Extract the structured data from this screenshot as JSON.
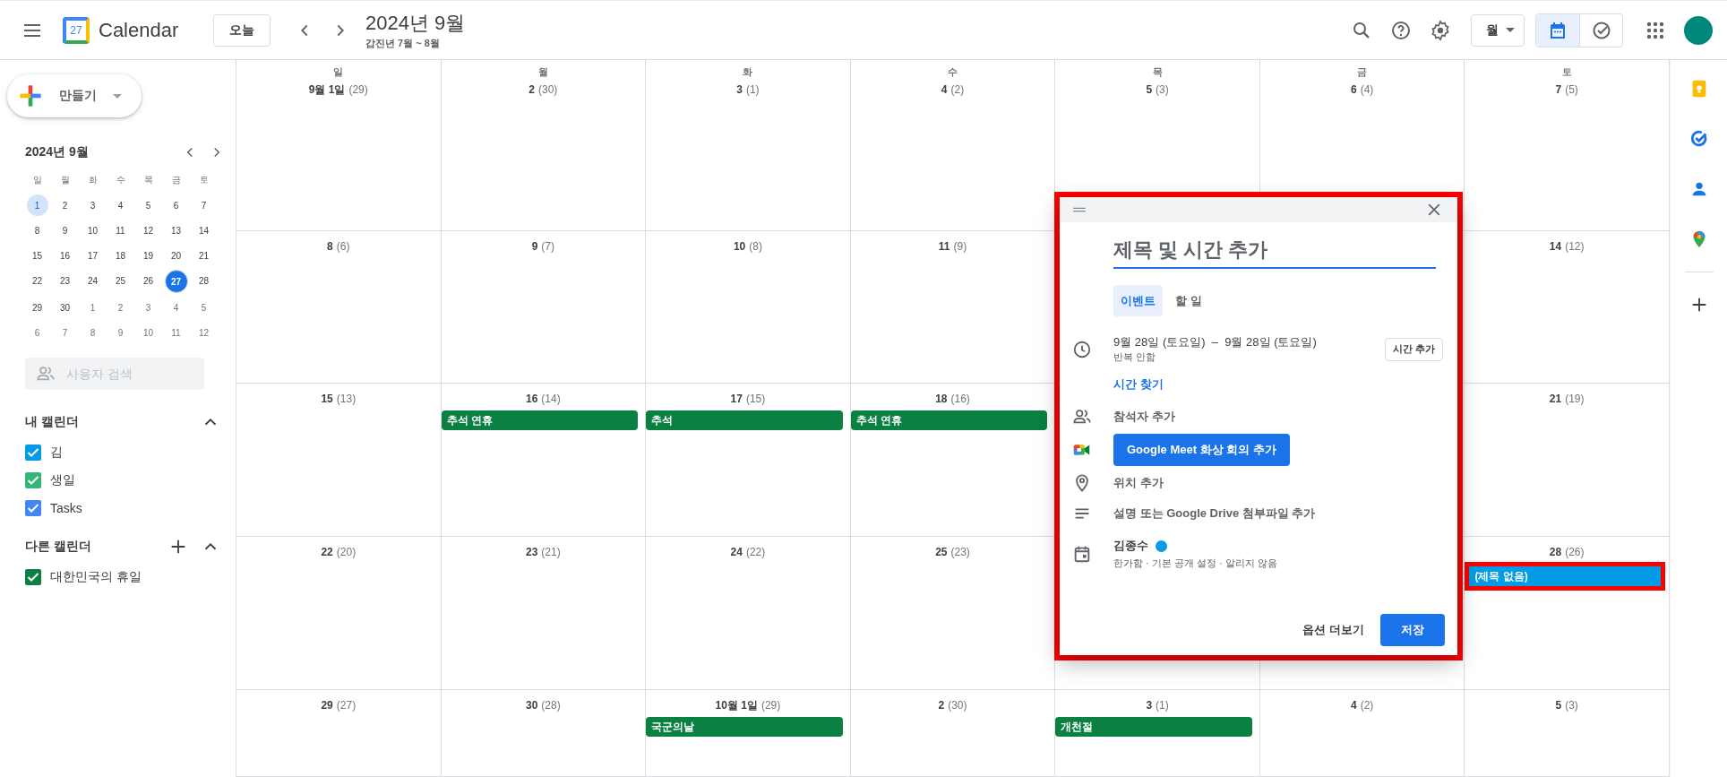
{
  "header": {
    "logo_number": "27",
    "app_name": "Calendar",
    "today_button": "오늘",
    "title": "2024년 9월",
    "subtitle": "갑진년 7월 ~ 8월",
    "view_dropdown": "월",
    "view_toggle": [
      {
        "kind": "calendar",
        "selected": true
      },
      {
        "kind": "tasks",
        "selected": false
      }
    ]
  },
  "sidebar": {
    "create_button": "만들기",
    "mini_calendar": {
      "title": "2024년 9월",
      "weekdays": [
        "일",
        "월",
        "화",
        "수",
        "목",
        "금",
        "토"
      ],
      "weeks": [
        [
          {
            "day": "1",
            "selected": true,
            "today": false,
            "other_month": false
          },
          {
            "day": "2",
            "selected": false,
            "today": false,
            "other_month": false
          },
          {
            "day": "3",
            "selected": false,
            "today": false,
            "other_month": false
          },
          {
            "day": "4",
            "selected": false,
            "today": false,
            "other_month": false
          },
          {
            "day": "5",
            "selected": false,
            "today": false,
            "other_month": false
          },
          {
            "day": "6",
            "selected": false,
            "today": false,
            "other_month": false
          },
          {
            "day": "7",
            "selected": false,
            "today": false,
            "other_month": false
          }
        ],
        [
          {
            "day": "8",
            "selected": false,
            "today": false,
            "other_month": false
          },
          {
            "day": "9",
            "selected": false,
            "today": false,
            "other_month": false
          },
          {
            "day": "10",
            "selected": false,
            "today": false,
            "other_month": false
          },
          {
            "day": "11",
            "selected": false,
            "today": false,
            "other_month": false
          },
          {
            "day": "12",
            "selected": false,
            "today": false,
            "other_month": false
          },
          {
            "day": "13",
            "selected": false,
            "today": false,
            "other_month": false
          },
          {
            "day": "14",
            "selected": false,
            "today": false,
            "other_month": false
          }
        ],
        [
          {
            "day": "15",
            "selected": false,
            "today": false,
            "other_month": false
          },
          {
            "day": "16",
            "selected": false,
            "today": false,
            "other_month": false
          },
          {
            "day": "17",
            "selected": false,
            "today": false,
            "other_month": false
          },
          {
            "day": "18",
            "selected": false,
            "today": false,
            "other_month": false
          },
          {
            "day": "19",
            "selected": false,
            "today": false,
            "other_month": false
          },
          {
            "day": "20",
            "selected": false,
            "today": false,
            "other_month": false
          },
          {
            "day": "21",
            "selected": false,
            "today": false,
            "other_month": false
          }
        ],
        [
          {
            "day": "22",
            "selected": false,
            "today": false,
            "other_month": false
          },
          {
            "day": "23",
            "selected": false,
            "today": false,
            "other_month": false
          },
          {
            "day": "24",
            "selected": false,
            "today": false,
            "other_month": false
          },
          {
            "day": "25",
            "selected": false,
            "today": false,
            "other_month": false
          },
          {
            "day": "26",
            "selected": false,
            "today": false,
            "other_month": false
          },
          {
            "day": "27",
            "selected": false,
            "today": true,
            "other_month": false
          },
          {
            "day": "28",
            "selected": false,
            "today": false,
            "other_month": false
          }
        ],
        [
          {
            "day": "29",
            "selected": false,
            "today": false,
            "other_month": false
          },
          {
            "day": "30",
            "selected": false,
            "today": false,
            "other_month": false
          },
          {
            "day": "1",
            "selected": false,
            "today": false,
            "other_month": true
          },
          {
            "day": "2",
            "selected": false,
            "today": false,
            "other_month": true
          },
          {
            "day": "3",
            "selected": false,
            "today": false,
            "other_month": true
          },
          {
            "day": "4",
            "selected": false,
            "today": false,
            "other_month": true
          },
          {
            "day": "5",
            "selected": false,
            "today": false,
            "other_month": true
          }
        ],
        [
          {
            "day": "6",
            "selected": false,
            "today": false,
            "other_month": true
          },
          {
            "day": "7",
            "selected": false,
            "today": false,
            "other_month": true
          },
          {
            "day": "8",
            "selected": false,
            "today": false,
            "other_month": true
          },
          {
            "day": "9",
            "selected": false,
            "today": false,
            "other_month": true
          },
          {
            "day": "10",
            "selected": false,
            "today": false,
            "other_month": true
          },
          {
            "day": "11",
            "selected": false,
            "today": false,
            "other_month": true
          },
          {
            "day": "12",
            "selected": false,
            "today": false,
            "other_month": true
          }
        ]
      ]
    },
    "people_search": {
      "placeholder": "사용자 검색"
    },
    "my_calendars": {
      "title": "내 캘린더",
      "items": [
        {
          "label": "김",
          "checked": true,
          "color": "#039be5"
        },
        {
          "label": "생일",
          "checked": true,
          "color": "#33b679"
        },
        {
          "label": "Tasks",
          "checked": true,
          "color": "#4285f4"
        }
      ]
    },
    "other_calendars": {
      "title": "다른 캘린더",
      "items": [
        {
          "label": "대한민국의 휴일",
          "checked": true,
          "color": "#0b8043"
        }
      ]
    }
  },
  "month_grid": {
    "weekdays": [
      "일",
      "월",
      "화",
      "수",
      "목",
      "금",
      "토"
    ],
    "weeks": [
      {
        "cells": [
          {
            "date": "9월 1일",
            "lunar": "(29)"
          },
          {
            "date": "2",
            "lunar": "(30)"
          },
          {
            "date": "3",
            "lunar": "(1)"
          },
          {
            "date": "4",
            "lunar": "(2)"
          },
          {
            "date": "5",
            "lunar": "(3)"
          },
          {
            "date": "6",
            "lunar": "(4)"
          },
          {
            "date": "7",
            "lunar": "(5)"
          }
        ]
      },
      {
        "cells": [
          {
            "date": "8",
            "lunar": "(6)"
          },
          {
            "date": "9",
            "lunar": "(7)"
          },
          {
            "date": "10",
            "lunar": "(8)"
          },
          {
            "date": "11",
            "lunar": "(9)"
          }
        ],
        "cells_after_dialog": [
          {
            "date": "14",
            "lunar": "(12)"
          }
        ]
      },
      {
        "cells": [
          {
            "date": "15",
            "lunar": "(13)"
          },
          {
            "date": "16",
            "lunar": "(14)",
            "events": [
              {
                "title": "추석 연휴",
                "color": "#0b8043",
                "highlighted": false
              }
            ]
          },
          {
            "date": "17",
            "lunar": "(15)",
            "events": [
              {
                "title": "추석",
                "color": "#0b8043",
                "highlighted": false
              }
            ]
          },
          {
            "date": "18",
            "lunar": "(16)",
            "events": [
              {
                "title": "추석 연휴",
                "color": "#0b8043",
                "highlighted": false
              }
            ]
          }
        ],
        "cells_after_dialog": [
          {
            "date": "21",
            "lunar": "(19)"
          }
        ]
      },
      {
        "cells": [
          {
            "date": "22",
            "lunar": "(20)"
          },
          {
            "date": "23",
            "lunar": "(21)"
          },
          {
            "date": "24",
            "lunar": "(22)"
          },
          {
            "date": "25",
            "lunar": "(23)"
          }
        ],
        "cells_after_dialog": [
          {
            "date": "28",
            "lunar": "(26)",
            "events": [
              {
                "title": "(제목 없음)",
                "color": "#039be5",
                "highlighted": true
              }
            ]
          }
        ]
      },
      {
        "cells": [
          {
            "date": "29",
            "lunar": "(27)"
          },
          {
            "date": "30",
            "lunar": "(28)"
          },
          {
            "date": "10월 1일",
            "lunar": "(29)",
            "events": [
              {
                "title": "국군의날",
                "color": "#0b8043",
                "highlighted": false
              }
            ]
          },
          {
            "date": "2",
            "lunar": "(30)"
          },
          {
            "date": "3",
            "lunar": "(1)",
            "events": [
              {
                "title": "개천절",
                "color": "#0b8043",
                "highlighted": false
              }
            ]
          },
          {
            "date": "4",
            "lunar": "(2)"
          },
          {
            "date": "5",
            "lunar": "(3)"
          }
        ]
      }
    ]
  },
  "event_dialog": {
    "highlighted": true,
    "title_placeholder": "제목 및 시간 추가",
    "tabs": [
      {
        "label": "이벤트",
        "selected": true
      },
      {
        "label": "할 일",
        "selected": false
      }
    ],
    "date_range": "9월 28일 (토요일)  –  9월 28일 (토요일)",
    "repeat": "반복 안함",
    "add_time_button": "시간 추가",
    "find_time_link": "시간 찾기",
    "guests": "참석자 추가",
    "meet_button": "Google Meet 화상 회의 추가",
    "location": "위치 추가",
    "description": "설명 또는 Google Drive 첨부파일 추가",
    "calendar": {
      "name": "김종수",
      "color": "#039be5",
      "details": "한가함 · 기본 공개 설정 · 알리지 않음"
    },
    "more_options": "옵션 더보기",
    "save_button": "저장"
  }
}
